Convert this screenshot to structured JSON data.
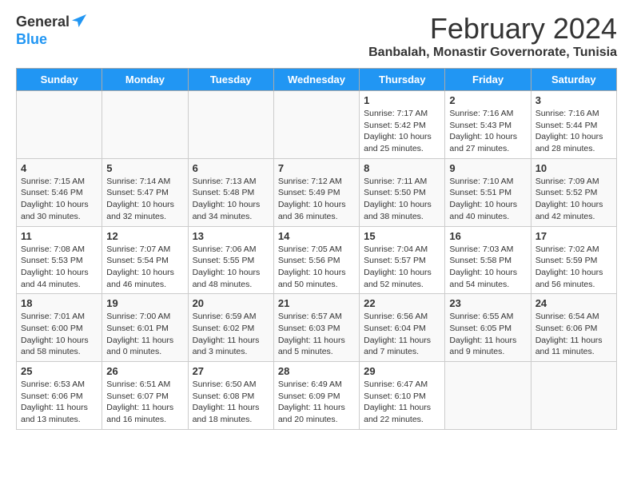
{
  "header": {
    "logo_general": "General",
    "logo_blue": "Blue",
    "month_title": "February 2024",
    "location": "Banbalah, Monastir Governorate, Tunisia"
  },
  "days_of_week": [
    "Sunday",
    "Monday",
    "Tuesday",
    "Wednesday",
    "Thursday",
    "Friday",
    "Saturday"
  ],
  "weeks": [
    [
      {
        "day": "",
        "info": ""
      },
      {
        "day": "",
        "info": ""
      },
      {
        "day": "",
        "info": ""
      },
      {
        "day": "",
        "info": ""
      },
      {
        "day": "1",
        "info": "Sunrise: 7:17 AM\nSunset: 5:42 PM\nDaylight: 10 hours\nand 25 minutes."
      },
      {
        "day": "2",
        "info": "Sunrise: 7:16 AM\nSunset: 5:43 PM\nDaylight: 10 hours\nand 27 minutes."
      },
      {
        "day": "3",
        "info": "Sunrise: 7:16 AM\nSunset: 5:44 PM\nDaylight: 10 hours\nand 28 minutes."
      }
    ],
    [
      {
        "day": "4",
        "info": "Sunrise: 7:15 AM\nSunset: 5:46 PM\nDaylight: 10 hours\nand 30 minutes."
      },
      {
        "day": "5",
        "info": "Sunrise: 7:14 AM\nSunset: 5:47 PM\nDaylight: 10 hours\nand 32 minutes."
      },
      {
        "day": "6",
        "info": "Sunrise: 7:13 AM\nSunset: 5:48 PM\nDaylight: 10 hours\nand 34 minutes."
      },
      {
        "day": "7",
        "info": "Sunrise: 7:12 AM\nSunset: 5:49 PM\nDaylight: 10 hours\nand 36 minutes."
      },
      {
        "day": "8",
        "info": "Sunrise: 7:11 AM\nSunset: 5:50 PM\nDaylight: 10 hours\nand 38 minutes."
      },
      {
        "day": "9",
        "info": "Sunrise: 7:10 AM\nSunset: 5:51 PM\nDaylight: 10 hours\nand 40 minutes."
      },
      {
        "day": "10",
        "info": "Sunrise: 7:09 AM\nSunset: 5:52 PM\nDaylight: 10 hours\nand 42 minutes."
      }
    ],
    [
      {
        "day": "11",
        "info": "Sunrise: 7:08 AM\nSunset: 5:53 PM\nDaylight: 10 hours\nand 44 minutes."
      },
      {
        "day": "12",
        "info": "Sunrise: 7:07 AM\nSunset: 5:54 PM\nDaylight: 10 hours\nand 46 minutes."
      },
      {
        "day": "13",
        "info": "Sunrise: 7:06 AM\nSunset: 5:55 PM\nDaylight: 10 hours\nand 48 minutes."
      },
      {
        "day": "14",
        "info": "Sunrise: 7:05 AM\nSunset: 5:56 PM\nDaylight: 10 hours\nand 50 minutes."
      },
      {
        "day": "15",
        "info": "Sunrise: 7:04 AM\nSunset: 5:57 PM\nDaylight: 10 hours\nand 52 minutes."
      },
      {
        "day": "16",
        "info": "Sunrise: 7:03 AM\nSunset: 5:58 PM\nDaylight: 10 hours\nand 54 minutes."
      },
      {
        "day": "17",
        "info": "Sunrise: 7:02 AM\nSunset: 5:59 PM\nDaylight: 10 hours\nand 56 minutes."
      }
    ],
    [
      {
        "day": "18",
        "info": "Sunrise: 7:01 AM\nSunset: 6:00 PM\nDaylight: 10 hours\nand 58 minutes."
      },
      {
        "day": "19",
        "info": "Sunrise: 7:00 AM\nSunset: 6:01 PM\nDaylight: 11 hours\nand 0 minutes."
      },
      {
        "day": "20",
        "info": "Sunrise: 6:59 AM\nSunset: 6:02 PM\nDaylight: 11 hours\nand 3 minutes."
      },
      {
        "day": "21",
        "info": "Sunrise: 6:57 AM\nSunset: 6:03 PM\nDaylight: 11 hours\nand 5 minutes."
      },
      {
        "day": "22",
        "info": "Sunrise: 6:56 AM\nSunset: 6:04 PM\nDaylight: 11 hours\nand 7 minutes."
      },
      {
        "day": "23",
        "info": "Sunrise: 6:55 AM\nSunset: 6:05 PM\nDaylight: 11 hours\nand 9 minutes."
      },
      {
        "day": "24",
        "info": "Sunrise: 6:54 AM\nSunset: 6:06 PM\nDaylight: 11 hours\nand 11 minutes."
      }
    ],
    [
      {
        "day": "25",
        "info": "Sunrise: 6:53 AM\nSunset: 6:06 PM\nDaylight: 11 hours\nand 13 minutes."
      },
      {
        "day": "26",
        "info": "Sunrise: 6:51 AM\nSunset: 6:07 PM\nDaylight: 11 hours\nand 16 minutes."
      },
      {
        "day": "27",
        "info": "Sunrise: 6:50 AM\nSunset: 6:08 PM\nDaylight: 11 hours\nand 18 minutes."
      },
      {
        "day": "28",
        "info": "Sunrise: 6:49 AM\nSunset: 6:09 PM\nDaylight: 11 hours\nand 20 minutes."
      },
      {
        "day": "29",
        "info": "Sunrise: 6:47 AM\nSunset: 6:10 PM\nDaylight: 11 hours\nand 22 minutes."
      },
      {
        "day": "",
        "info": ""
      },
      {
        "day": "",
        "info": ""
      }
    ]
  ]
}
